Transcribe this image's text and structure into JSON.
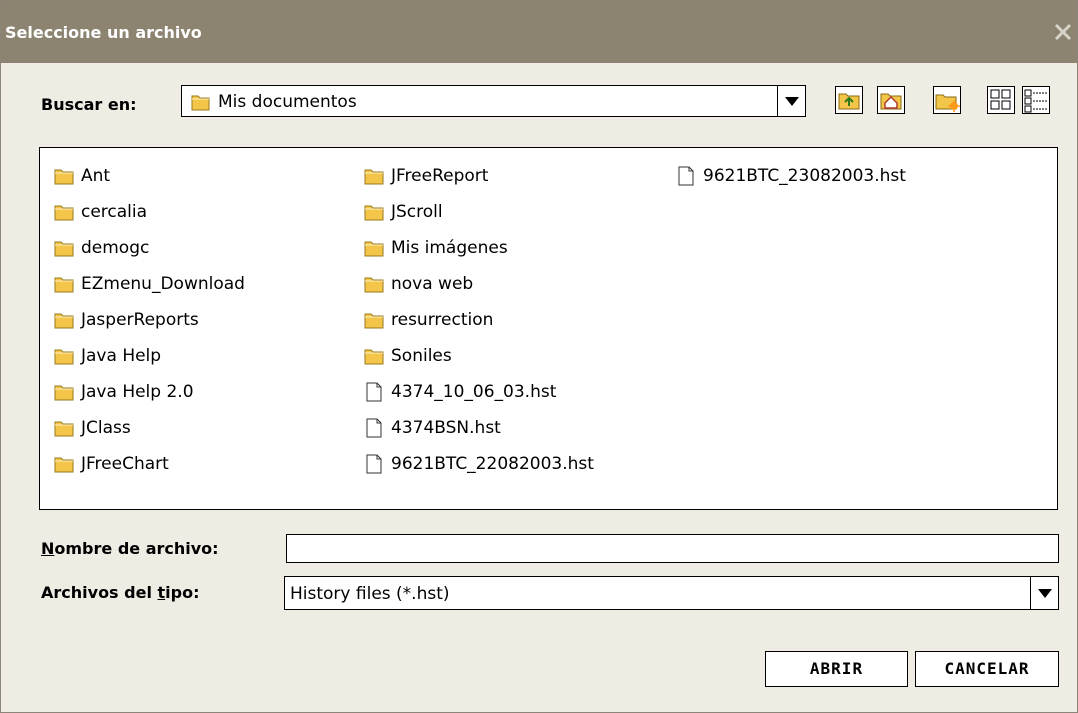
{
  "dialog": {
    "title": "Seleccione un archivo"
  },
  "look_in": {
    "label_pre": "Buscar en:",
    "value": "Mis documentos"
  },
  "toolbar": [
    {
      "icon": "up-folder-icon"
    },
    {
      "icon": "home-icon"
    },
    {
      "icon": "new-folder-icon"
    },
    {
      "icon": "list-view-icon"
    },
    {
      "icon": "details-view-icon"
    }
  ],
  "files": {
    "columns": [
      [
        {
          "name": "Ant",
          "type": "folder"
        },
        {
          "name": "cercalia",
          "type": "folder"
        },
        {
          "name": "demogc",
          "type": "folder"
        },
        {
          "name": "EZmenu_Download",
          "type": "folder"
        },
        {
          "name": "JasperReports",
          "type": "folder"
        },
        {
          "name": "Java Help",
          "type": "folder"
        },
        {
          "name": "Java Help 2.0",
          "type": "folder"
        },
        {
          "name": "JClass",
          "type": "folder"
        },
        {
          "name": "JFreeChart",
          "type": "folder"
        }
      ],
      [
        {
          "name": "JFreeReport",
          "type": "folder"
        },
        {
          "name": "JScroll",
          "type": "folder"
        },
        {
          "name": "Mis imágenes",
          "type": "folder"
        },
        {
          "name": "nova web",
          "type": "folder"
        },
        {
          "name": "resurrection",
          "type": "folder"
        },
        {
          "name": "Soniles",
          "type": "folder"
        },
        {
          "name": "4374_10_06_03.hst",
          "type": "file"
        },
        {
          "name": "4374BSN.hst",
          "type": "file"
        },
        {
          "name": "9621BTC_22082003.hst",
          "type": "file"
        }
      ],
      [
        {
          "name": "9621BTC_23082003.hst",
          "type": "file"
        }
      ]
    ]
  },
  "filename": {
    "label_mnemonic": "N",
    "label_rest": "ombre de archivo:",
    "value": ""
  },
  "filetype": {
    "label_pre": "Archivos del ",
    "label_mnemonic": "t",
    "label_post": "ipo:",
    "value": "History files (*.hst)"
  },
  "buttons": {
    "open": "ABRIR",
    "cancel": "CANCELAR"
  },
  "colors": {
    "titlebar": "#8c8470",
    "background": "#efece4",
    "folder": "#f3c64a"
  }
}
